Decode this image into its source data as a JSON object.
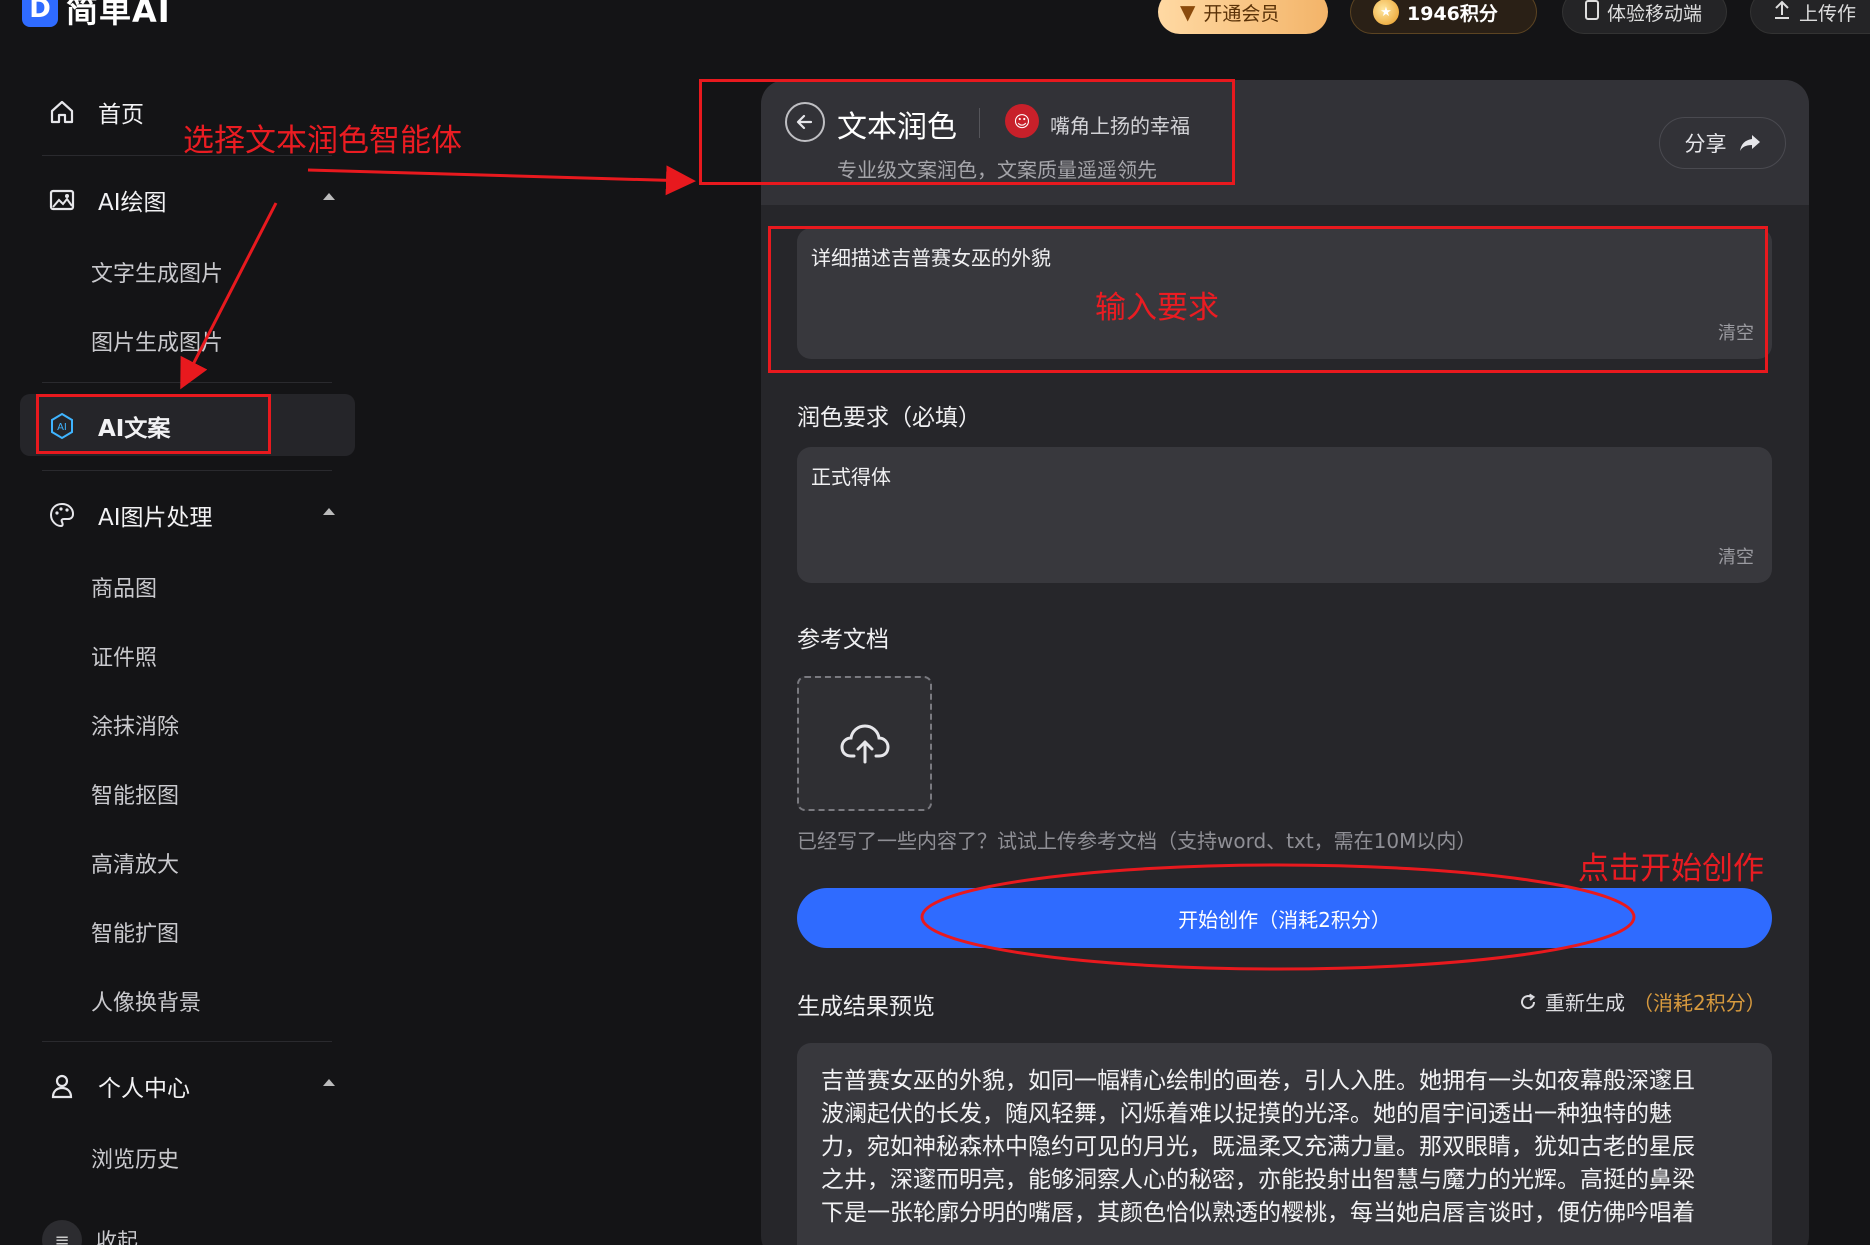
{
  "header": {
    "logo_mark": "D",
    "logo_text": "简单AI",
    "vip_label": "开通会员",
    "points_label": "1946积分",
    "mobile_label": "体验移动端",
    "upload_label": "上传作"
  },
  "sidebar": {
    "home": "首页",
    "ai_draw": "AI绘图",
    "ai_draw_items": [
      "文字生成图片",
      "图片生成图片"
    ],
    "ai_copy": "AI文案",
    "ai_image": "AI图片处理",
    "ai_image_items": [
      "商品图",
      "证件照",
      "涂抹消除",
      "智能抠图",
      "高清放大",
      "智能扩图",
      "人像换背景"
    ],
    "personal": "个人中心",
    "personal_items": [
      "浏览历史"
    ],
    "collapse": "收起"
  },
  "panel": {
    "title": "文本润色",
    "author": "嘴角上扬的幸福",
    "subtitle": "专业级文案润色，文案质量遥遥领先",
    "share": "分享",
    "input_value": "详细描述吉普赛女巫的外貌",
    "clear_label": "清空",
    "polish_label": "润色要求（必填）",
    "polish_value": "正式得体",
    "reference_label": "参考文档",
    "upload_hint": "已经写了一些内容了？试试上传参考文档（支持word、txt，需在10M以内）",
    "start_button": "开始创作（消耗2积分）",
    "result_label": "生成结果预览",
    "regenerate": "重新生成",
    "regenerate_cost": "（消耗2积分）",
    "result_lines": [
      "吉普赛女巫的外貌，如同一幅精心绘制的画卷，引人入胜。她拥有一头如夜幕般深邃且",
      "波澜起伏的长发，随风轻舞，闪烁着难以捉摸的光泽。她的眉宇间透出一种独特的魅",
      "力，宛如神秘森林中隐约可见的月光，既温柔又充满力量。那双眼睛，犹如古老的星辰",
      "之井，深邃而明亮，能够洞察人心的秘密，亦能投射出智慧与魔力的光辉。高挺的鼻梁",
      "下是一张轮廓分明的嘴唇，其颜色恰似熟透的樱桃，每当她启唇言谈时，便仿佛吟唱着"
    ]
  },
  "annotations": {
    "choose_agent": "选择文本润色智能体",
    "input_requirement": "输入要求",
    "click_start": "点击开始创作"
  },
  "colors": {
    "accent": "#2f6bff",
    "annotation": "#e8191e",
    "cost": "#d79a3e"
  }
}
